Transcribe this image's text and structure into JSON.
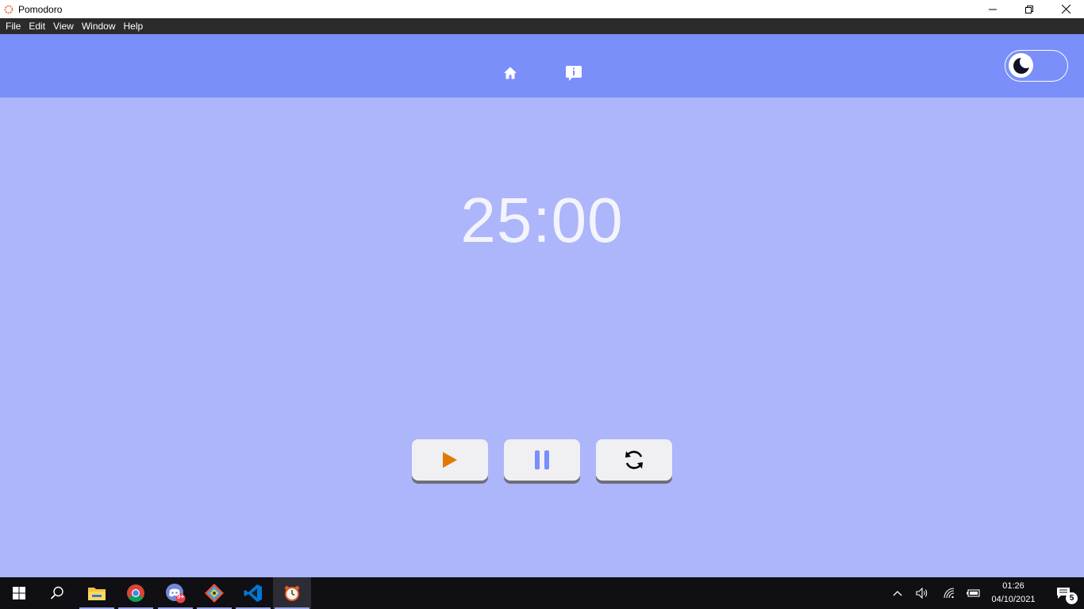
{
  "window": {
    "title": "Pomodoro",
    "controls": {
      "minimize": "minimize-icon",
      "restore": "restore-icon",
      "close": "close-icon"
    }
  },
  "menu": {
    "items": [
      "File",
      "Edit",
      "View",
      "Window",
      "Help"
    ]
  },
  "header": {
    "nav": [
      {
        "icon": "home-icon"
      },
      {
        "icon": "info-icon"
      }
    ],
    "theme_toggle": {
      "icon": "moon-icon",
      "state": "off"
    },
    "colors": {
      "header": "#7a8ff9",
      "background": "#adb5fb"
    }
  },
  "timer": {
    "display": "25:00"
  },
  "controls": [
    {
      "icon": "play-icon",
      "color": "#e07b00"
    },
    {
      "icon": "pause-icon",
      "color": "#7a8ff9"
    },
    {
      "icon": "reset-icon",
      "color": "#000000"
    }
  ],
  "taskbar": {
    "apps": [
      "windows-start-icon",
      "search-icon",
      "file-explorer-icon",
      "chrome-icon",
      "discord-icon",
      "git-icon",
      "vscode-icon",
      "pomodoro-icon"
    ],
    "discord_badge": "9+",
    "tray": [
      "chevron-up-icon",
      "volume-icon",
      "wifi-icon",
      "battery-icon"
    ],
    "time": "01:26",
    "date": "04/10/2021",
    "notifications_count": "5"
  }
}
